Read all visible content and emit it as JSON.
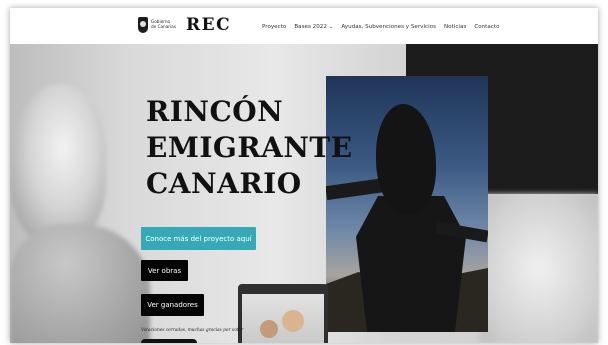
{
  "header": {
    "gov_logo_text": "Gobierno\nde Canarias",
    "brand": "REC",
    "nav": [
      "Proyecto",
      "Bases 2022 ⌄",
      "Ayudas, Subvenciones y Servicios",
      "Noticias",
      "Contacto"
    ]
  },
  "hero": {
    "title_lines": [
      "RINCÓN",
      "EMIGRANTE",
      "CANARIO"
    ],
    "cta_primary": "Conoce más del proyecto aquí",
    "cta_obras": "Ver obras",
    "cta_ganadores": "Ver ganadores",
    "tagline": "Votaciones cerradas, muchas gracias por votar"
  },
  "colors": {
    "accent_teal": "#35aab6",
    "button_dark": "#050505",
    "text_dark": "#111111"
  }
}
